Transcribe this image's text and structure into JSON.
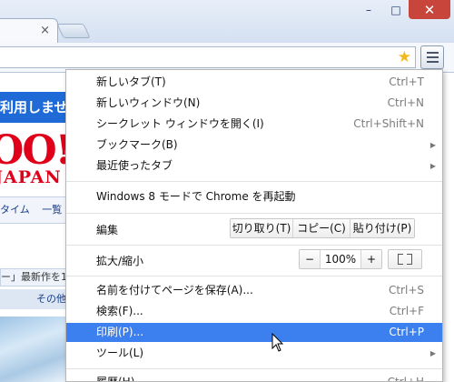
{
  "window": {
    "minimize": "–",
    "maximize": "□",
    "close": "✕"
  },
  "tab": {
    "close": "×"
  },
  "page_bg": {
    "banner": "利用しませ",
    "logo_big": "OO!",
    "logo_small": "JAPAN",
    "nav": [
      "タイム",
      "一覧"
    ],
    "news": "ー」最新作を1",
    "other": "その他"
  },
  "menu": {
    "items": [
      {
        "label": "新しいタブ(T)",
        "shortcut": "Ctrl+T"
      },
      {
        "label": "新しいウィンドウ(N)",
        "shortcut": "Ctrl+N"
      },
      {
        "label": "シークレット ウィンドウを開く(I)",
        "shortcut": "Ctrl+Shift+N"
      },
      {
        "label": "ブックマーク(B)",
        "arrow": "▶"
      },
      {
        "label": "最近使ったタブ",
        "arrow": "▶"
      },
      {
        "label": "Windows 8 モードで Chrome を再起動"
      },
      {
        "label": "名前を付けてページを保存(A)...",
        "shortcut": "Ctrl+S"
      },
      {
        "label": "検索(F)...",
        "shortcut": "Ctrl+F"
      },
      {
        "label": "印刷(P)...",
        "shortcut": "Ctrl+P"
      },
      {
        "label": "ツール(L)",
        "arrow": "▶"
      },
      {
        "label": "履歴(H)",
        "shortcut": "Ctrl+H"
      }
    ],
    "edit": {
      "label": "編集",
      "cut": "切り取り(T)",
      "copy": "コピー(C)",
      "paste": "貼り付け(P)"
    },
    "zoom": {
      "label": "拡大/縮小",
      "minus": "−",
      "value": "100%",
      "plus": "+"
    }
  },
  "colors": {
    "highlight": "#3b80ee",
    "close_button": "#c7453a"
  }
}
